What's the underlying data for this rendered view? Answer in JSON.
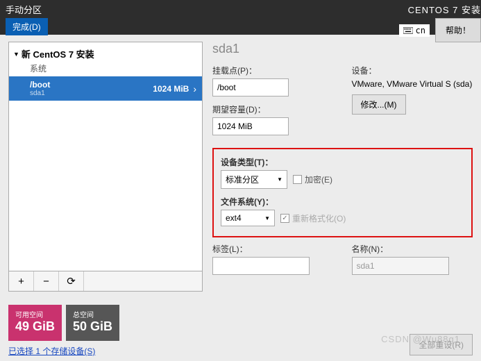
{
  "header": {
    "title": "手动分区",
    "done": "完成(D)",
    "install_label": "CENTOS 7 安装",
    "keyboard": "cn",
    "help": "帮助！"
  },
  "tree": {
    "root": "新 CentOS 7 安装",
    "system": "系统",
    "items": [
      {
        "mount": "/boot",
        "device": "sda1",
        "size": "1024 MiB"
      }
    ]
  },
  "toolbar": {
    "add": "+",
    "remove": "−",
    "reload": "⟳"
  },
  "detail": {
    "partition_title": "sda1",
    "mount_label": "挂载点(P)：",
    "mount_value": "/boot",
    "capacity_label": "期望容量(D)：",
    "capacity_value": "1024 MiB",
    "device_label": "设备：",
    "device_text": "VMware, VMware Virtual S (sda)",
    "modify": "修改...(M)",
    "type_label": "设备类型(T)：",
    "type_value": "标准分区",
    "encrypt": "加密(E)",
    "fs_label": "文件系统(Y)：",
    "fs_value": "ext4",
    "reformat": "重新格式化(O)",
    "tag_label": "标签(L)：",
    "tag_value": "",
    "name_label": "名称(N)：",
    "name_value": "sda1"
  },
  "space": {
    "avail_label": "可用空间",
    "avail_value": "49 GiB",
    "total_label": "总空间",
    "total_value": "50 GiB"
  },
  "storage_link": "已选择 1 个存储设备(S)",
  "reset_all": "全部重设(R)",
  "watermark": "CSDN @Wu88g1"
}
